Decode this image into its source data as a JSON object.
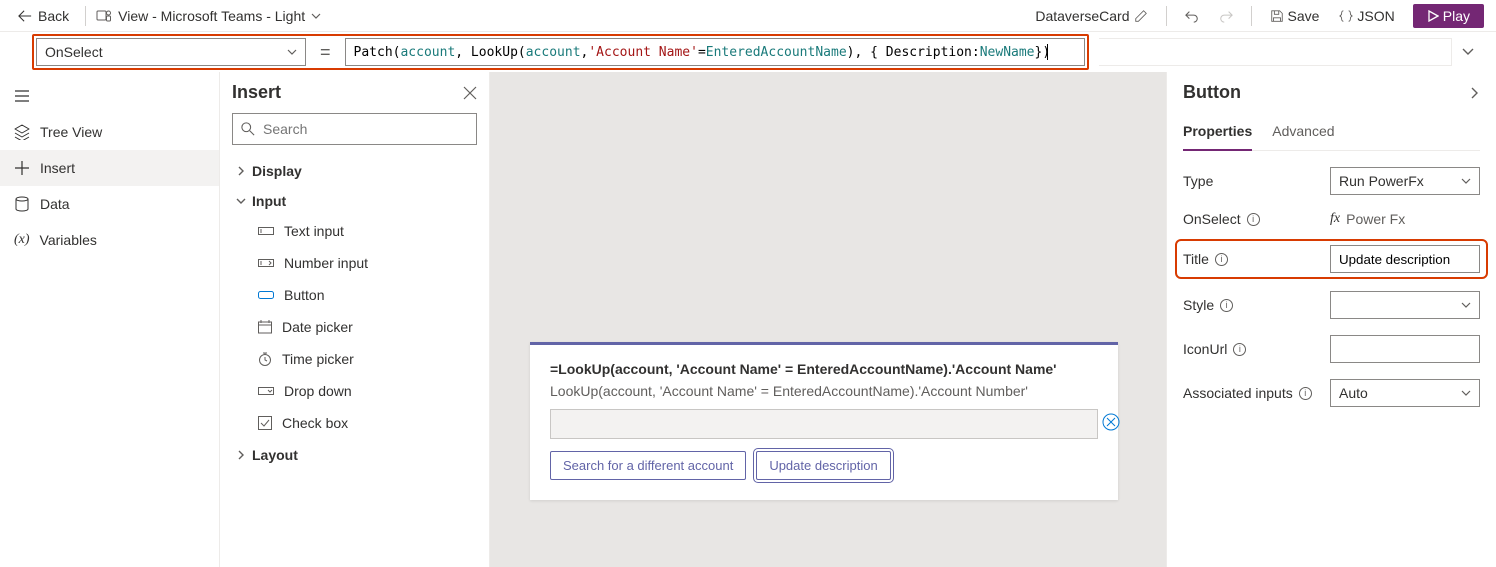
{
  "toolbar": {
    "back": "Back",
    "view_label": "View - Microsoft Teams - Light",
    "card_name": "DataverseCard",
    "save": "Save",
    "json": "JSON",
    "play": "Play"
  },
  "formula": {
    "property": "OnSelect",
    "segments": {
      "s1": "Patch",
      "s2": "(",
      "s3": "account",
      "s4": ", LookUp(",
      "s5": "account",
      "s6": ", ",
      "s7": "'Account Name'",
      "s8": " = ",
      "s9": "EnteredAccountName",
      "s10": "), { Description: ",
      "s11": "NewName",
      "s12": " })"
    }
  },
  "leftnav": {
    "tree": "Tree View",
    "insert": "Insert",
    "data": "Data",
    "vars": "Variables"
  },
  "insert": {
    "title": "Insert",
    "search_ph": "Search",
    "groups": {
      "display": "Display",
      "input": "Input",
      "layout": "Layout"
    },
    "items": {
      "text_input": "Text input",
      "number_input": "Number input",
      "button": "Button",
      "date_picker": "Date picker",
      "time_picker": "Time picker",
      "drop_down": "Drop down",
      "check_box": "Check box"
    }
  },
  "card": {
    "line1": "=LookUp(account, 'Account Name' = EnteredAccountName).'Account Name'",
    "line2": "LookUp(account, 'Account Name' = EnteredAccountName).'Account Number'",
    "btn1": "Search for a different account",
    "btn2": "Update description"
  },
  "props": {
    "heading": "Button",
    "tab_props": "Properties",
    "tab_adv": "Advanced",
    "type": {
      "label": "Type",
      "value": "Run PowerFx"
    },
    "onselect": {
      "label": "OnSelect",
      "fx": "Power Fx"
    },
    "title": {
      "label": "Title",
      "value": "Update description"
    },
    "style": {
      "label": "Style",
      "value": ""
    },
    "iconurl": {
      "label": "IconUrl",
      "value": ""
    },
    "assoc": {
      "label": "Associated inputs",
      "value": "Auto"
    }
  }
}
